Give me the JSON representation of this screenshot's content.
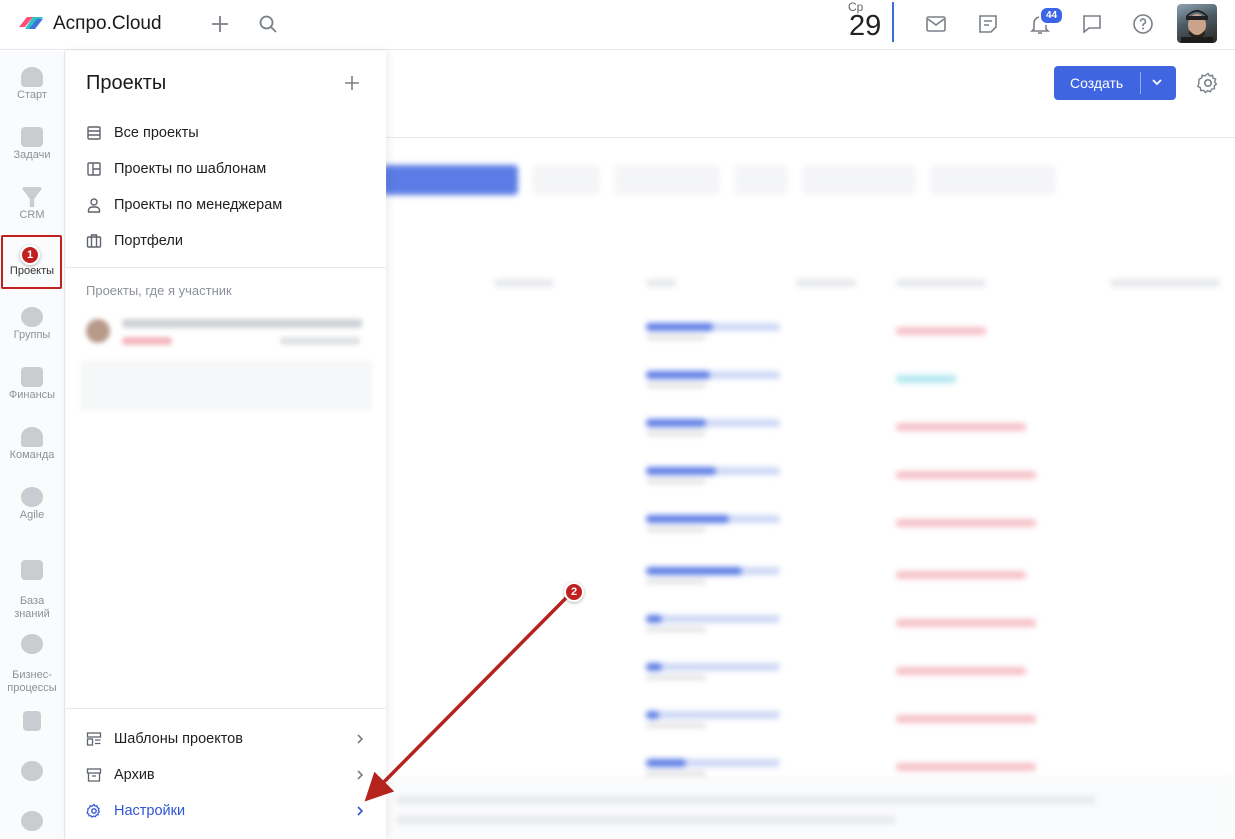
{
  "app": {
    "brand": "Аспро.Cloud"
  },
  "date": {
    "weekday": "Ср",
    "day": "29"
  },
  "notifications": {
    "count": "44"
  },
  "leftnav": {
    "items": [
      {
        "id": "start",
        "label": "Старт"
      },
      {
        "id": "tasks",
        "label": "Задачи"
      },
      {
        "id": "crm",
        "label": "CRM"
      },
      {
        "id": "projects",
        "label": "Проекты"
      },
      {
        "id": "groups",
        "label": "Группы"
      },
      {
        "id": "finance",
        "label": "Финансы"
      },
      {
        "id": "team",
        "label": "Команда"
      },
      {
        "id": "agile",
        "label": "Agile"
      },
      {
        "id": "kb",
        "label": "База\nзнаний"
      },
      {
        "id": "bp",
        "label": "Бизнес-\nпроцессы"
      }
    ]
  },
  "markers": {
    "first": "1",
    "second": "2"
  },
  "panel": {
    "title": "Проекты",
    "items": [
      {
        "label": "Все проекты"
      },
      {
        "label": "Проекты по шаблонам"
      },
      {
        "label": "Проекты по менеджерам"
      },
      {
        "label": "Портфели"
      }
    ],
    "section_label": "Проекты, где я участник",
    "bottom_items": [
      {
        "label": "Шаблоны проектов"
      },
      {
        "label": "Архив"
      },
      {
        "label": "Настройки"
      }
    ]
  },
  "main": {
    "create_label": "Создать"
  },
  "colors": {
    "accent": "#3f66e0",
    "marker": "#c0201e",
    "overdue": "#e8455a"
  }
}
